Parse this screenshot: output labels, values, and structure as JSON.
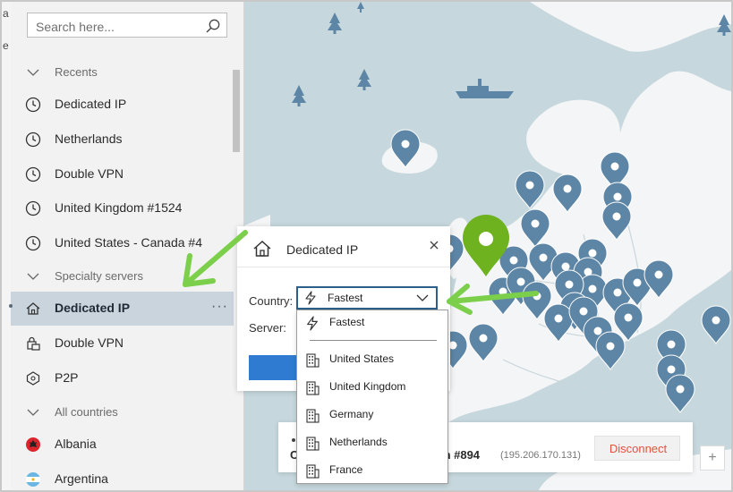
{
  "search": {
    "placeholder": "Search here..."
  },
  "edge_chars": [
    "a",
    "e"
  ],
  "sidebar": {
    "items": [
      {
        "label": "Recents",
        "type": "section"
      },
      {
        "label": "Dedicated IP",
        "type": "recent"
      },
      {
        "label": "Netherlands",
        "type": "recent"
      },
      {
        "label": "Double VPN",
        "type": "recent"
      },
      {
        "label": "United Kingdom #1524",
        "type": "recent"
      },
      {
        "label": "United States - Canada #4",
        "type": "recent"
      },
      {
        "label": "Specialty servers",
        "type": "section"
      },
      {
        "label": "Dedicated IP",
        "type": "specialty-active",
        "more": "···"
      },
      {
        "label": "Double VPN",
        "type": "specialty"
      },
      {
        "label": "P2P",
        "type": "specialty"
      },
      {
        "label": "All countries",
        "type": "section"
      },
      {
        "label": "Albania",
        "type": "country"
      },
      {
        "label": "Argentina",
        "type": "country"
      }
    ]
  },
  "popup": {
    "title": "Dedicated IP",
    "country_label": "Country:",
    "server_label": "Server:",
    "selected": "Fastest"
  },
  "dropdown": {
    "options": [
      {
        "label": "Fastest",
        "icon": "bolt-icon"
      },
      {
        "label": "United States",
        "icon": "building-icon"
      },
      {
        "label": "United Kingdom",
        "icon": "building-icon"
      },
      {
        "label": "Germany",
        "icon": "building-icon"
      },
      {
        "label": "Netherlands",
        "icon": "building-icon"
      },
      {
        "label": "France",
        "icon": "building-icon"
      }
    ]
  },
  "status": {
    "server_partial": "om #894",
    "ip": "(195.206.170.131)",
    "disconnect_label": "Disconnect",
    "left_char": "C"
  },
  "zoom": {
    "in_label": "+"
  },
  "colors": {
    "accent": "#2f7bd1",
    "pin": "#5d85a5",
    "pin_active": "#6fb21f",
    "land": "#f4f5f6",
    "water": "#c6d8dd",
    "annotation_arrow": "#7ccf4b",
    "disconnect": "#e0533b"
  }
}
